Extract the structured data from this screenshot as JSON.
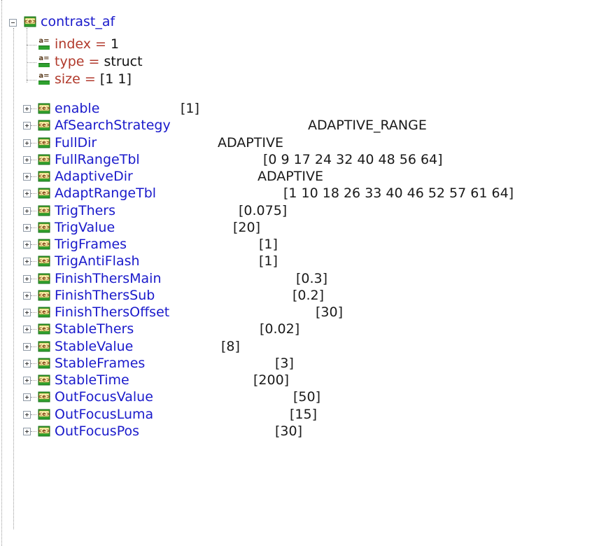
{
  "root": {
    "name": "contrast_af",
    "icon": "struct-icon"
  },
  "fields": [
    {
      "key": "index",
      "op": "=",
      "value": "1"
    },
    {
      "key": "type",
      "op": "=",
      "value": "struct"
    },
    {
      "key": "size",
      "op": "=",
      "value": "[1 1]"
    }
  ],
  "items": [
    {
      "name": "enable",
      "value": "[1]"
    },
    {
      "name": "AfSearchStrategy",
      "value": "ADAPTIVE_RANGE"
    },
    {
      "name": "FullDir",
      "value": "ADAPTIVE"
    },
    {
      "name": "FullRangeTbl",
      "value": "[0 9 17 24 32 40 48 56 64]"
    },
    {
      "name": "AdaptiveDir",
      "value": "ADAPTIVE"
    },
    {
      "name": "AdaptRangeTbl",
      "value": "[1 10 18  26 33 40 46 52 57  61 64]"
    },
    {
      "name": "TrigThers",
      "value": "[0.075]"
    },
    {
      "name": "TrigValue",
      "value": "[20]"
    },
    {
      "name": "TrigFrames",
      "value": "[1]"
    },
    {
      "name": "TrigAntiFlash",
      "value": "[1]"
    },
    {
      "name": "FinishThersMain",
      "value": "[0.3]"
    },
    {
      "name": "FinishThersSub",
      "value": "[0.2]"
    },
    {
      "name": "FinishThersOffset",
      "value": "[30]"
    },
    {
      "name": "StableThers",
      "value": "[0.02]"
    },
    {
      "name": "StableValue",
      "value": "[8]"
    },
    {
      "name": "StableFrames",
      "value": "[3]"
    },
    {
      "name": "StableTime",
      "value": "[200]"
    },
    {
      "name": "OutFocusValue",
      "value": "[50]"
    },
    {
      "name": "OutFocusLuma",
      "value": "[15]"
    },
    {
      "name": "OutFocusPos",
      "value": "[30]"
    }
  ],
  "colors": {
    "struct_label": "#1a1acb",
    "field_label": "#b13a2c",
    "icon_green": "#2fa12f"
  }
}
